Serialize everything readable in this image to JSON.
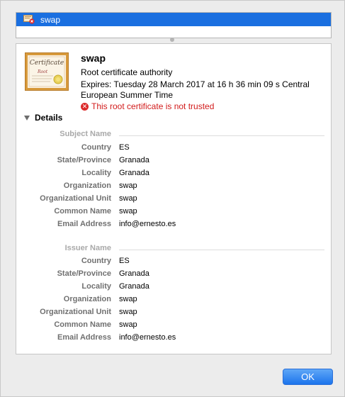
{
  "cert_list": {
    "selected_item": "swap"
  },
  "certificate": {
    "name": "swap",
    "kind": "Root certificate authority",
    "expires": "Expires: Tuesday 28 March 2017 at 16 h 36 min 09 s Central European Summer Time",
    "trust_status": "This root certificate is not trusted",
    "icon_script_text": "Certificate",
    "icon_root_text": "Root"
  },
  "details": {
    "toggle_label": "Details",
    "subject": {
      "heading": "Subject Name",
      "fields": [
        {
          "label": "Country",
          "value": "ES"
        },
        {
          "label": "State/Province",
          "value": "Granada"
        },
        {
          "label": "Locality",
          "value": "Granada"
        },
        {
          "label": "Organization",
          "value": "swap"
        },
        {
          "label": "Organizational Unit",
          "value": "swap"
        },
        {
          "label": "Common Name",
          "value": "swap"
        },
        {
          "label": "Email Address",
          "value": "info@ernesto.es"
        }
      ]
    },
    "issuer": {
      "heading": "Issuer Name",
      "fields": [
        {
          "label": "Country",
          "value": "ES"
        },
        {
          "label": "State/Province",
          "value": "Granada"
        },
        {
          "label": "Locality",
          "value": "Granada"
        },
        {
          "label": "Organization",
          "value": "swap"
        },
        {
          "label": "Organizational Unit",
          "value": "swap"
        },
        {
          "label": "Common Name",
          "value": "swap"
        },
        {
          "label": "Email Address",
          "value": "info@ernesto.es"
        }
      ]
    }
  },
  "footer": {
    "ok_label": "OK"
  },
  "colors": {
    "selection": "#1a6fe0",
    "error": "#d21b1b",
    "accent_button": "#1c74ec"
  }
}
